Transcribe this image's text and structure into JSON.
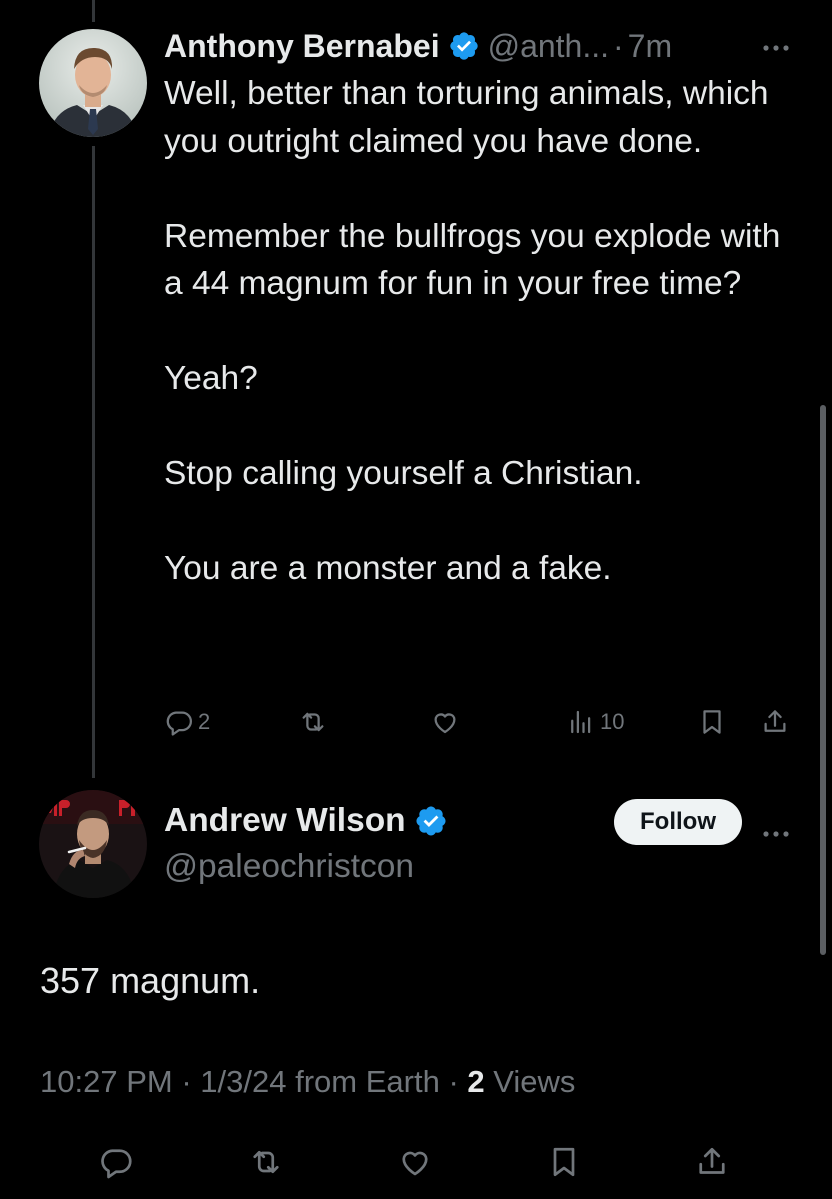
{
  "colors": {
    "background": "#000000",
    "text_primary": "#e7e9ea",
    "text_secondary": "#71767b",
    "verified_blue": "#1d9bf0",
    "follow_bg": "#eff3f4"
  },
  "reply": {
    "author_name": "Anthony Bernabei",
    "author_handle": "@anth...",
    "separator": "·",
    "time": "7m",
    "more_icon": "more-horizontal-icon",
    "body": [
      "Well, better than torturing animals, which you outright claimed you have done.",
      "Remember the bullfrogs you explode with a 44 magnum for fun in your free time?",
      "Yeah?",
      "Stop calling yourself a Christian.",
      "You are a monster and a fake."
    ],
    "actions": {
      "reply_count": "2",
      "views_count": "10"
    }
  },
  "main_tweet": {
    "author_name": "Andrew Wilson",
    "author_handle": "@paleochristcon",
    "follow_label": "Follow",
    "text": "357 magnum.",
    "time": "10:27 PM",
    "date": "1/3/24",
    "source": "from Earth",
    "views_count": "2",
    "views_label": "Views",
    "separator": "·"
  }
}
